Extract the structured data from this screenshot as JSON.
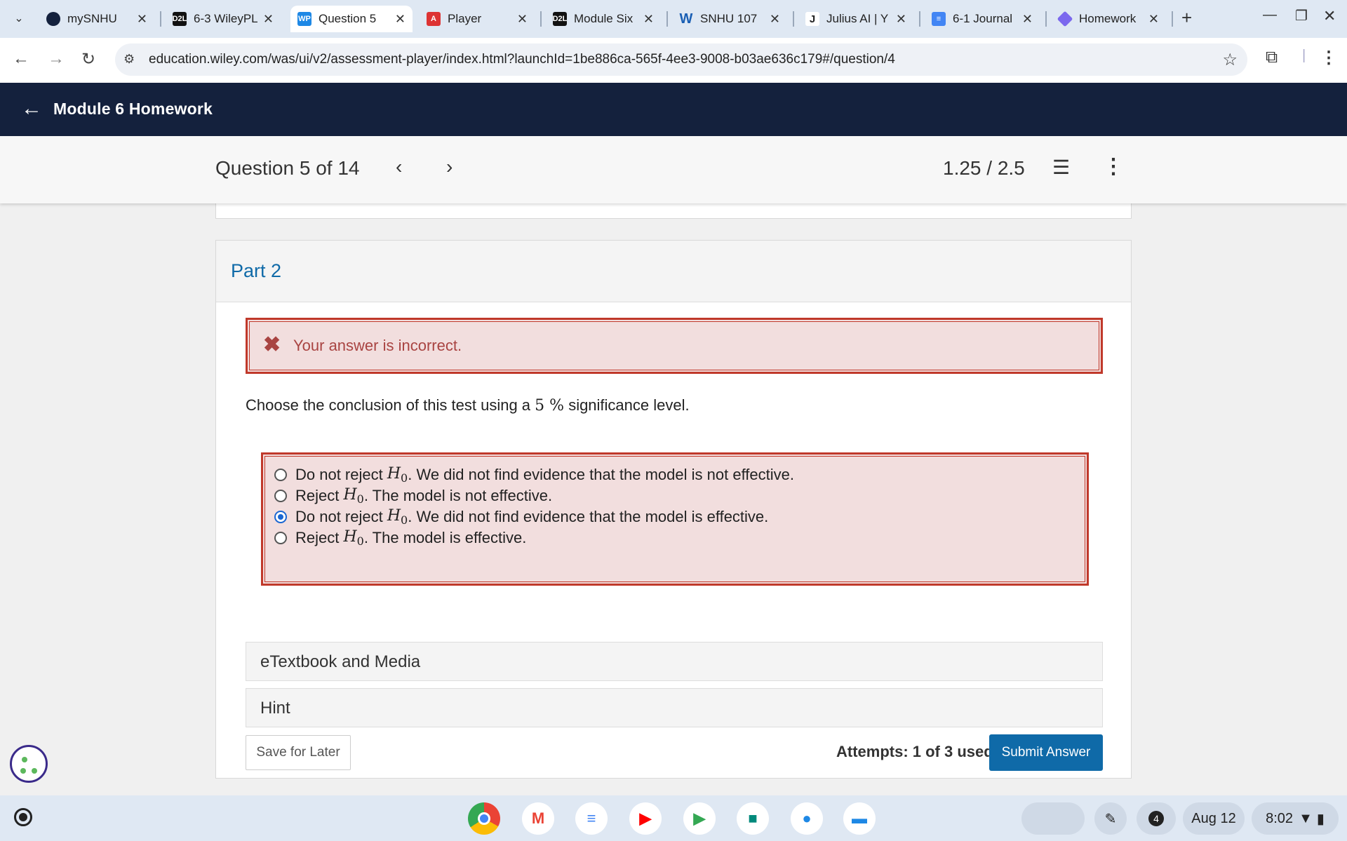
{
  "browser": {
    "tabs": [
      {
        "label": "mySNHU",
        "favicon_text": "",
        "favicon_color": "#14213d"
      },
      {
        "label": "6-3 WileyPL",
        "favicon_text": "D2L",
        "favicon_color": "#111111"
      },
      {
        "label": "Question 5",
        "favicon_text": "WP",
        "favicon_color": "#1e88e5"
      },
      {
        "label": "Player",
        "favicon_text": "A",
        "favicon_color": "#dd3333"
      },
      {
        "label": "Module Six",
        "favicon_text": "D2L",
        "favicon_color": "#111111"
      },
      {
        "label": "SNHU 107",
        "favicon_text": "W",
        "favicon_color": "#1a5fb4"
      },
      {
        "label": "Julius AI | Y",
        "favicon_text": "J",
        "favicon_color": "#222222"
      },
      {
        "label": "6-1 Journal",
        "favicon_text": "",
        "favicon_color": "#4285f4"
      },
      {
        "label": "Homework",
        "favicon_text": "",
        "favicon_color": "#7b68ee"
      }
    ],
    "url": "education.wiley.com/was/ui/v2/assessment-player/index.html?launchId=1be886ca-565f-4ee3-9008-b03ae636c179#/question/4"
  },
  "app": {
    "title": "Module 6 Homework",
    "question_label": "Question 5 of 14",
    "score": "1.25 / 2.5"
  },
  "part": {
    "title": "Part 2",
    "feedback": "Your answer is incorrect.",
    "prompt_before": "Choose the conclusion of this test using a",
    "prompt_value": "5 %",
    "prompt_after": "significance level.",
    "choices": [
      {
        "pre": "Do not reject",
        "post": ". We did not find evidence that the model is not effective.",
        "selected": false
      },
      {
        "pre": "Reject",
        "post": ". The model is not effective.",
        "selected": false
      },
      {
        "pre": "Do not reject",
        "post": ". We did not find evidence that the model is effective.",
        "selected": true
      },
      {
        "pre": "Reject",
        "post": ". The model is effective.",
        "selected": false
      }
    ],
    "hyp_symbol": "H",
    "hyp_sub": "0",
    "etextbook_label": "eTextbook and Media",
    "hint_label": "Hint",
    "save_label": "Save for Later",
    "attempts": "Attempts: 1 of 3 used",
    "submit_label": "Submit Answer"
  },
  "shelf": {
    "notifications": "4",
    "date": "Aug 12",
    "time": "8:02"
  }
}
